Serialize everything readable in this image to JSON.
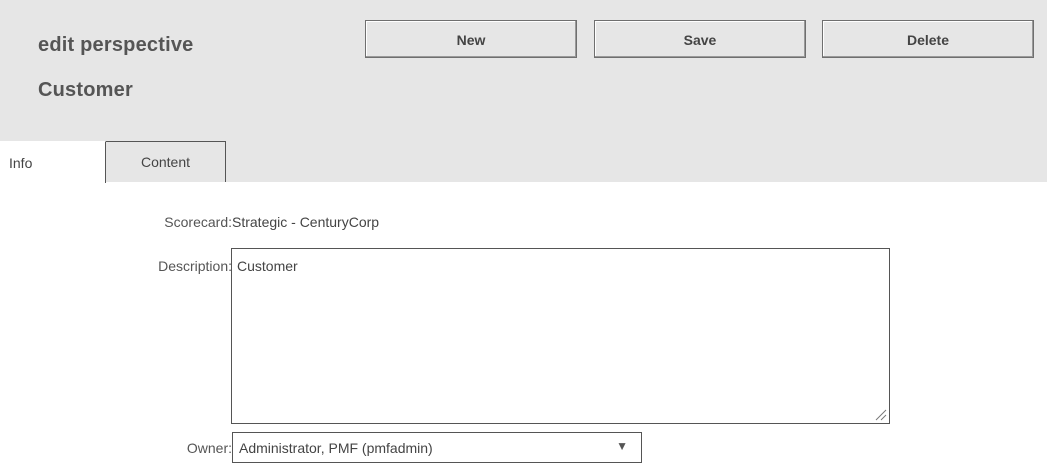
{
  "header": {
    "title": "edit perspective",
    "subtitle": "Customer"
  },
  "toolbar": {
    "new_label": "New",
    "save_label": "Save",
    "delete_label": "Delete"
  },
  "tabs": [
    {
      "label": "Info",
      "active": true
    },
    {
      "label": "Content",
      "active": false
    }
  ],
  "form": {
    "scorecard_label": "Scorecard:",
    "scorecard_value": "Strategic - CenturyCorp",
    "description_label": "Description:",
    "description_value": "Customer",
    "owner_label": "Owner:",
    "owner_value": "Administrator, PMF (pmfadmin)",
    "owner_arrow_icon": "dropdown-triangle-icon"
  },
  "colors": {
    "header_bg": "#e6e6e6",
    "text": "#444444",
    "border": "#555555"
  }
}
